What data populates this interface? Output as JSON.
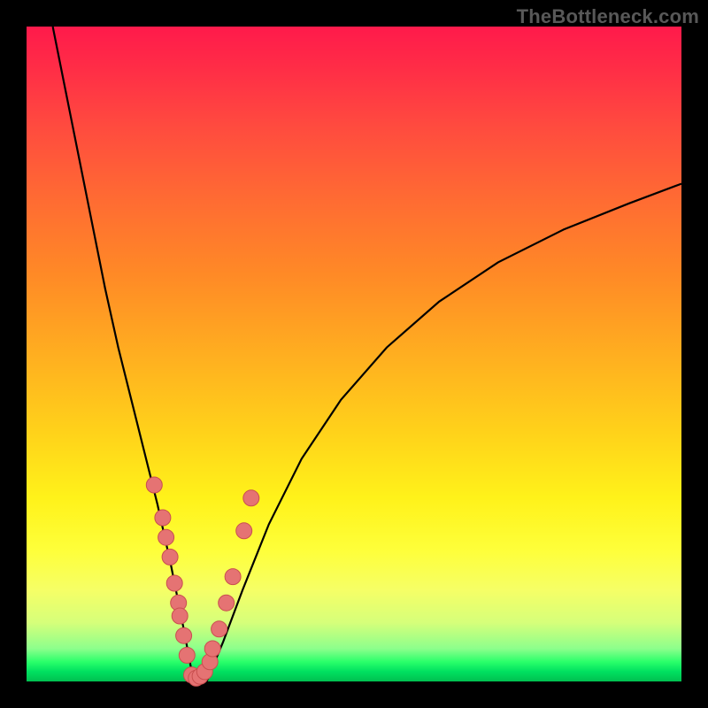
{
  "watermark": {
    "text": "TheBottleneck.com"
  },
  "colors": {
    "frame": "#000000",
    "curve_stroke": "#000000",
    "marker_fill": "#e57373",
    "marker_stroke": "#c94f4f"
  },
  "chart_data": {
    "type": "line",
    "title": "",
    "xlabel": "",
    "ylabel": "",
    "xlim": [
      0,
      100
    ],
    "ylim": [
      0,
      100
    ],
    "series": [
      {
        "name": "bottleneck-curve",
        "x": [
          4,
          6,
          8,
          10,
          12,
          14,
          16,
          18,
          20,
          22,
          24,
          25.5,
          27.5,
          30,
          33,
          37,
          42,
          48,
          55,
          63,
          72,
          82,
          92,
          100
        ],
        "y": [
          100,
          90,
          80,
          70,
          60,
          51,
          43,
          35,
          27,
          18,
          8,
          0,
          0,
          6,
          14,
          24,
          34,
          43,
          51,
          58,
          64,
          69,
          73,
          76
        ]
      }
    ],
    "markers": {
      "name": "data-points",
      "x": [
        19.5,
        20.8,
        21.3,
        21.9,
        22.6,
        23.2,
        23.4,
        24.0,
        24.5,
        25.2,
        25.9,
        26.5,
        27.2,
        28.0,
        28.4,
        29.4,
        30.5,
        31.5,
        33.2,
        34.3
      ],
      "y": [
        30,
        25,
        22,
        19,
        15,
        12,
        10,
        7,
        4,
        1,
        0.5,
        0.8,
        1.5,
        3,
        5,
        8,
        12,
        16,
        23,
        28
      ]
    }
  }
}
